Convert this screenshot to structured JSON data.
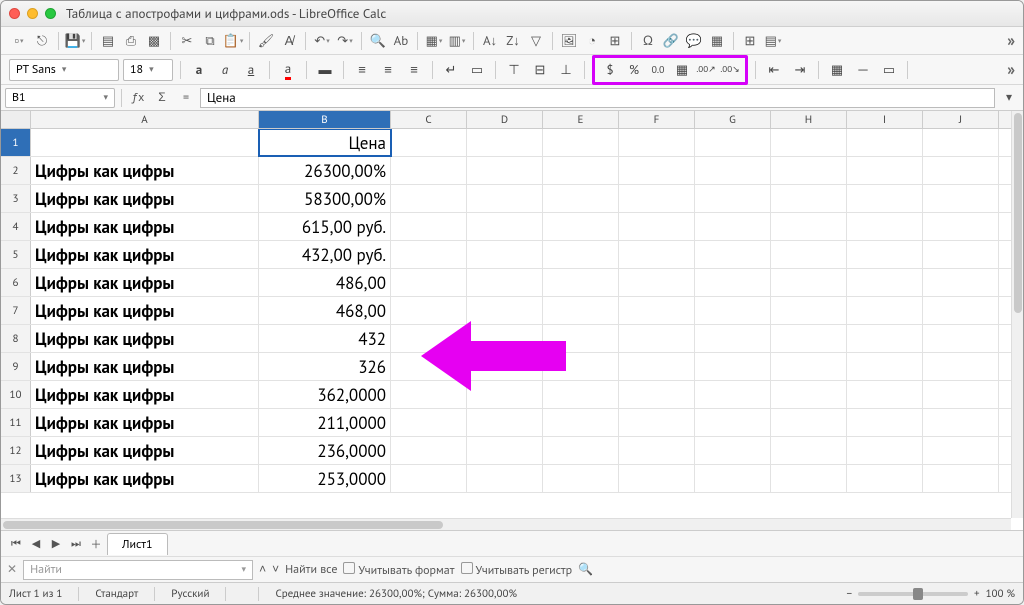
{
  "window": {
    "title": "Таблица с апострофами и цифрами.ods - LibreOffice Calc"
  },
  "font": {
    "name": "PT Sans",
    "size": "18"
  },
  "cellref": {
    "name": "B1",
    "formula": "Цена"
  },
  "numfmt": {
    "currency": "$",
    "percent": "%",
    "number": "0.0",
    "date": "▦",
    "add_dec": ".00↗",
    "del_dec": ".00↘"
  },
  "columns": [
    "A",
    "B",
    "C",
    "D",
    "E",
    "F",
    "G",
    "H",
    "I",
    "J"
  ],
  "rows": [
    {
      "n": "1",
      "a": "",
      "b": "Цена"
    },
    {
      "n": "2",
      "a": "Цифры как цифры",
      "b": "26300,00%"
    },
    {
      "n": "3",
      "a": "Цифры как цифры",
      "b": "58300,00%"
    },
    {
      "n": "4",
      "a": "Цифры как цифры",
      "b": "615,00 руб."
    },
    {
      "n": "5",
      "a": "Цифры как цифры",
      "b": "432,00 руб."
    },
    {
      "n": "6",
      "a": "Цифры как цифры",
      "b": "486,00"
    },
    {
      "n": "7",
      "a": "Цифры как цифры",
      "b": "468,00"
    },
    {
      "n": "8",
      "a": "Цифры как цифры",
      "b": "432"
    },
    {
      "n": "9",
      "a": "Цифры как цифры",
      "b": "326"
    },
    {
      "n": "10",
      "a": "Цифры как цифры",
      "b": "362,0000"
    },
    {
      "n": "11",
      "a": "Цифры как цифры",
      "b": "211,0000"
    },
    {
      "n": "12",
      "a": "Цифры как цифры",
      "b": "236,0000"
    },
    {
      "n": "13",
      "a": "Цифры как цифры",
      "b": "253,0000"
    }
  ],
  "sheet": {
    "tab": "Лист1"
  },
  "find": {
    "placeholder": "Найти",
    "all": "Найти все",
    "match_fmt": "Учитывать формат",
    "match_case": "Учитывать регистр"
  },
  "status": {
    "sheet": "Лист 1 из 1",
    "style": "Стандарт",
    "lang": "Русский",
    "insert": "",
    "summary": "Среднее значение: 26300,00%; Сумма: 26300,00%",
    "zoom": "100 %"
  }
}
